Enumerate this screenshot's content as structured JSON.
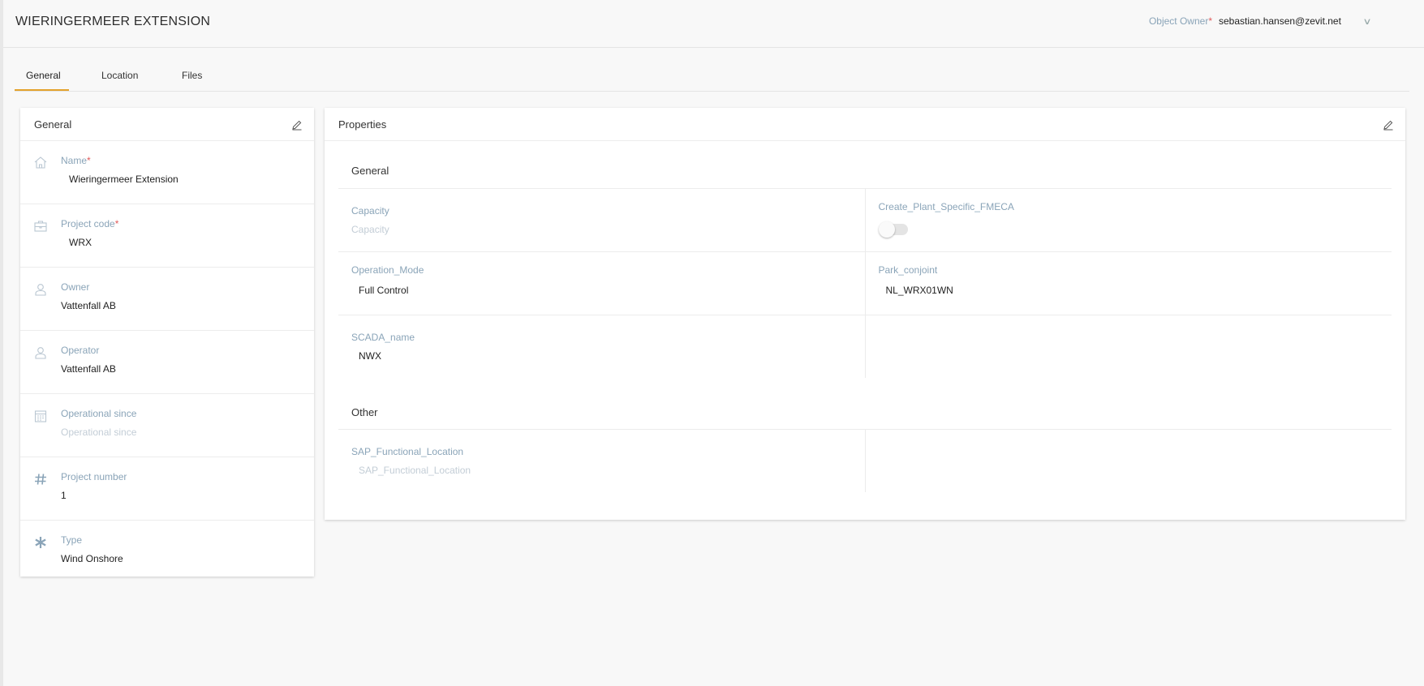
{
  "header": {
    "title": "WIERINGERMEER EXTENSION",
    "owner_label": "Object Owner",
    "owner_required": "*",
    "owner_value": "sebastian.hansen@zevit.net"
  },
  "tabs": [
    {
      "label": "General",
      "active": true
    },
    {
      "label": "Location",
      "active": false
    },
    {
      "label": "Files",
      "active": false
    }
  ],
  "general_card": {
    "title": "General",
    "fields": [
      {
        "icon": "home-icon",
        "label": "Name",
        "required": "*",
        "value": "Wieringermeer Extension"
      },
      {
        "icon": "briefcase-icon",
        "label": "Project code",
        "required": "*",
        "value": "WRX"
      },
      {
        "icon": "user-icon",
        "label": "Owner",
        "value": "Vattenfall AB"
      },
      {
        "icon": "user-icon",
        "label": "Operator",
        "value": "Vattenfall AB"
      },
      {
        "icon": "calendar-icon",
        "label": "Operational since",
        "placeholder": "Operational since"
      },
      {
        "icon": "hash-icon",
        "label": "Project number",
        "value": "1"
      },
      {
        "icon": "asterisk-icon",
        "label": "Type",
        "value": "Wind Onshore"
      }
    ]
  },
  "properties_card": {
    "title": "Properties",
    "sections": [
      {
        "title": "General",
        "fields": [
          {
            "label": "Capacity",
            "placeholder": "Capacity"
          },
          {
            "label": "Create_Plant_Specific_FMECA",
            "toggle_on": false
          },
          {
            "label": "Operation_Mode",
            "value": "Full Control"
          },
          {
            "label": "Park_conjoint",
            "value": "NL_WRX01WN"
          },
          {
            "label": "SCADA_name",
            "value": "NWX"
          }
        ]
      },
      {
        "title": "Other",
        "fields": [
          {
            "label": "SAP_Functional_Location",
            "placeholder": "SAP_Functional_Location"
          }
        ]
      }
    ]
  },
  "colors": {
    "accent": "#e3a22c",
    "label": "#8aa4b8",
    "required": "#e05a5a",
    "placeholder": "#c3cdd6"
  }
}
